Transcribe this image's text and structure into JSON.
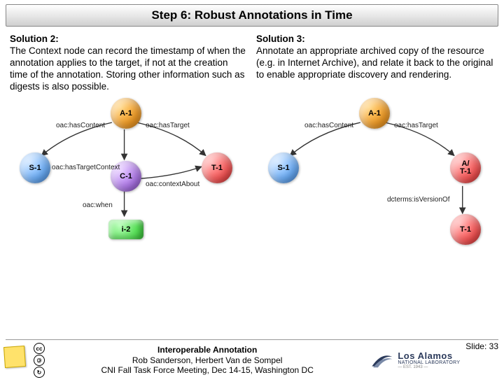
{
  "title": "Step 6: Robust Annotations in Time",
  "solution2": {
    "heading": "Solution 2:",
    "body": "The Context node can record the timestamp of when the annotation applies to the target, if not at the creation time of the annotation. Storing other information such as digests is also possible."
  },
  "solution3": {
    "heading": "Solution 3:",
    "body": "Annotate an appropriate archived copy of the resource (e.g. in Internet Archive), and relate it back to the original to enable appropriate discovery and rendering."
  },
  "diagram_left": {
    "nodes": {
      "a": "A-1",
      "s": "S-1",
      "t": "T-1",
      "c": "C-1",
      "i": "i-2"
    },
    "edges": {
      "hasContent": "oac:hasContent",
      "hasTarget": "oac:hasTarget",
      "hasTargetContext": "oac:hasTargetContext",
      "contextAbout": "oac:contextAbout",
      "when": "oac:when"
    }
  },
  "diagram_right": {
    "nodes": {
      "a": "A-1",
      "s": "S-1",
      "at": "A/\nT-1",
      "t": "T-1"
    },
    "edges": {
      "hasContent": "oac:hasContent",
      "hasTarget": "oac:hasTarget",
      "isVersionOf": "dcterms:isVersionOf"
    }
  },
  "footer": {
    "line1": "Interoperable Annotation",
    "line2": "Rob Sanderson, Herbert Van de Sompel",
    "line3": "CNI Fall Task Force Meeting, Dec 14-15, Washington DC",
    "slide": "Slide: 33",
    "lab_top": "Los Alamos",
    "lab_mid": "NATIONAL LABORATORY",
    "lab_est": "— EST. 1943 —"
  }
}
